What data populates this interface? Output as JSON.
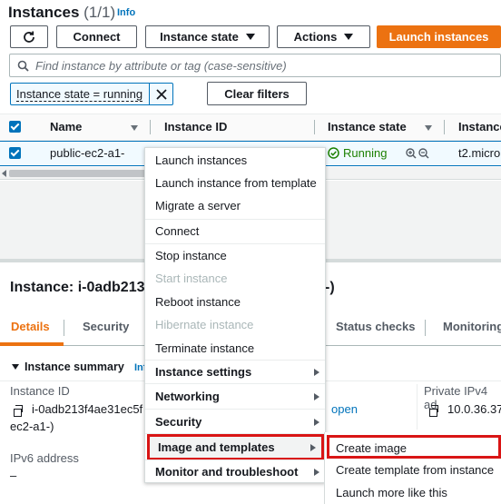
{
  "header": {
    "title": "Instances",
    "count": "(1/1)",
    "info": "Info"
  },
  "toolbar": {
    "refresh_icon": "refresh-icon",
    "connect": "Connect",
    "instance_state": "Instance state",
    "actions": "Actions",
    "launch": "Launch instances"
  },
  "search": {
    "placeholder": "Find instance by attribute or tag (case-sensitive)"
  },
  "filter": {
    "token": "Instance state = running",
    "clear": "Clear filters"
  },
  "table": {
    "columns": [
      "Name",
      "Instance ID",
      "Instance state",
      "Instance"
    ],
    "row": {
      "name": "public-ec2-a1-",
      "state": "Running",
      "type": "t2.micro"
    }
  },
  "details": {
    "title_left": "Instance: i-0adb213",
    "title_right": "-)",
    "tabs": [
      "Details",
      "Security",
      "Status checks",
      "Monitoring"
    ],
    "summary": "Instance summary",
    "summary_info": "Info",
    "instance_id_label": "Instance ID",
    "instance_id_value": "i-0adb213f4ae31ec5f",
    "instance_id_suffix": "ec2-a1-)",
    "open_link": "open",
    "private_ip_label": "Private IPv4 ad",
    "private_ip_value": "10.0.36.37",
    "ipv6_label": "IPv6 address",
    "ipv6_value": "–"
  },
  "menu": {
    "items": [
      "Launch instances",
      "Launch instance from template",
      "Migrate a server",
      "Connect",
      "Stop instance",
      "Start instance",
      "Reboot instance",
      "Hibernate instance",
      "Terminate instance",
      "Instance settings",
      "Networking",
      "Security",
      "Image and templates",
      "Monitor and troubleshoot"
    ]
  },
  "submenu": {
    "items": [
      "Create image",
      "Create template from instance",
      "Launch more like this"
    ]
  },
  "colors": {
    "accent": "#ec7211",
    "link": "#0073bb",
    "running": "#1d8102",
    "highlight": "#d91515"
  }
}
